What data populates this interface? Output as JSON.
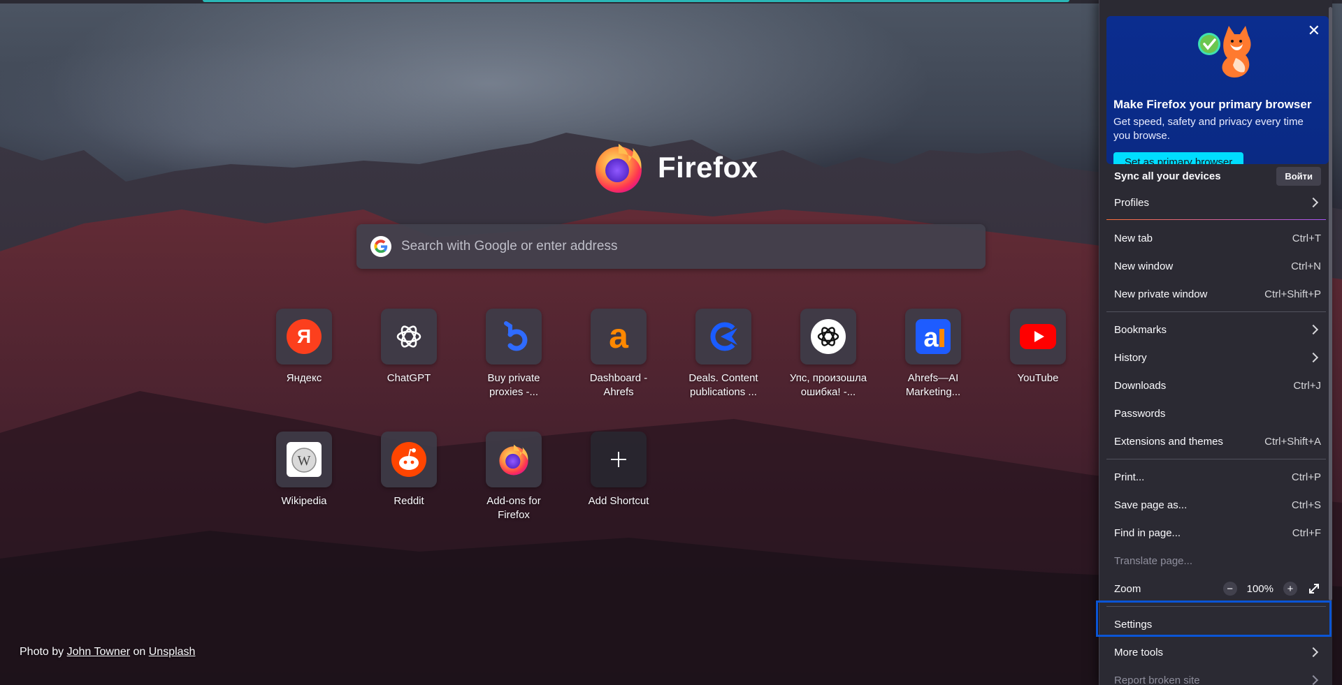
{
  "brand": {
    "name": "Firefox"
  },
  "search": {
    "placeholder": "Search with Google or enter address"
  },
  "shortcuts": [
    {
      "label_lines": [
        "Яндекс"
      ],
      "icon": "yandex-icon"
    },
    {
      "label_lines": [
        "ChatGPT"
      ],
      "icon": "openai-icon"
    },
    {
      "label_lines": [
        "Buy private",
        "proxies -..."
      ],
      "icon": "proxy-b-icon"
    },
    {
      "label_lines": [
        "Dashboard -",
        "Ahrefs"
      ],
      "icon": "ahrefs-a-icon"
    },
    {
      "label_lines": [
        "Deals. Content",
        "publications ..."
      ],
      "icon": "deals-arrow-icon"
    },
    {
      "label_lines": [
        "Упс, произошла",
        "ошибка! -..."
      ],
      "icon": "openai-white-icon"
    },
    {
      "label_lines": [
        "Ahrefs—AI",
        "Marketing..."
      ],
      "icon": "ahrefs-ai-icon"
    },
    {
      "label_lines": [
        "YouTube"
      ],
      "icon": "youtube-icon"
    },
    {
      "label_lines": [
        "Wikipedia"
      ],
      "icon": "wikipedia-icon"
    },
    {
      "label_lines": [
        "Reddit"
      ],
      "icon": "reddit-icon"
    },
    {
      "label_lines": [
        "Add-ons for",
        "Firefox"
      ],
      "icon": "firefox-addons-icon"
    },
    {
      "label_lines": [
        "Add Shortcut"
      ],
      "icon": "plus-icon"
    }
  ],
  "credit": {
    "prefix": "Photo by",
    "author": "John Towner",
    "on": "on",
    "site": "Unsplash"
  },
  "menu": {
    "promo": {
      "title": "Make Firefox your primary browser",
      "description": "Get speed, safety and privacy every time you browse.",
      "button": "Set as primary browser",
      "close": "✕"
    },
    "sync": {
      "label": "Sync all your devices",
      "signin": "Войти"
    },
    "profiles": "Profiles",
    "items_group1": [
      {
        "label": "New tab",
        "shortcut": "Ctrl+T"
      },
      {
        "label": "New window",
        "shortcut": "Ctrl+N"
      },
      {
        "label": "New private window",
        "shortcut": "Ctrl+Shift+P"
      }
    ],
    "items_group2": [
      {
        "label": "Bookmarks",
        "shortcut": ""
      },
      {
        "label": "History",
        "shortcut": ""
      },
      {
        "label": "Downloads",
        "shortcut": "Ctrl+J"
      },
      {
        "label": "Passwords",
        "shortcut": ""
      },
      {
        "label": "Extensions and themes",
        "shortcut": "Ctrl+Shift+A"
      }
    ],
    "items_group3": [
      {
        "label": "Print...",
        "shortcut": "Ctrl+P"
      },
      {
        "label": "Save page as...",
        "shortcut": "Ctrl+S"
      },
      {
        "label": "Find in page...",
        "shortcut": "Ctrl+F"
      },
      {
        "label": "Translate page...",
        "shortcut": ""
      }
    ],
    "zoom": {
      "label": "Zoom",
      "minus": "−",
      "value": "100%",
      "plus": "+"
    },
    "settings": "Settings",
    "more_tools": "More tools",
    "report": "Report broken site"
  },
  "colors": {
    "accent": "#00ddff",
    "highlight": "#0a55d6",
    "menu_bg": "#2b2a33"
  }
}
